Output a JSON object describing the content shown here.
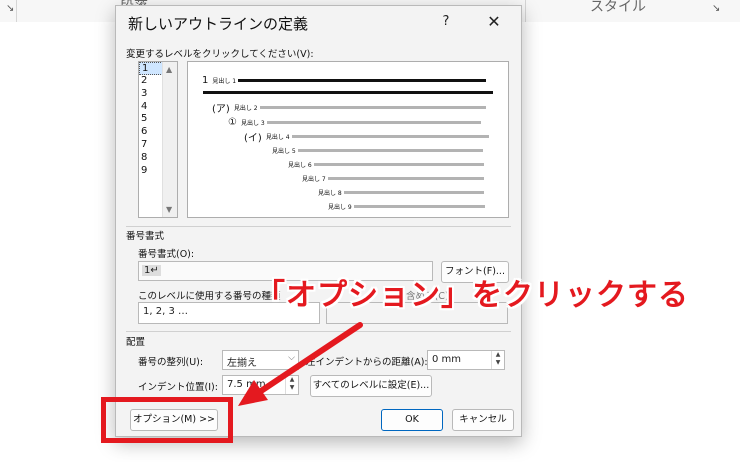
{
  "background": {
    "ribbon_left_label": "段落",
    "ribbon_right_label": "スタイル",
    "launcher_glyph": "↘"
  },
  "dialog": {
    "title": "新しいアウトラインの定義",
    "help_glyph": "?",
    "close_glyph": "✕",
    "level_prompt": "変更するレベルをクリックしてください(V):",
    "levels": [
      "1",
      "2",
      "3",
      "4",
      "5",
      "6",
      "7",
      "8",
      "9"
    ],
    "selected_level": "1",
    "preview": [
      {
        "number": "1",
        "label": "見出し 1"
      },
      {
        "number": "(ア)",
        "label": "見出し 2"
      },
      {
        "number": "①",
        "label": "見出し 3"
      },
      {
        "number": "(イ)",
        "label": "見出し 4"
      },
      {
        "number": "",
        "label": "見出し 5"
      },
      {
        "number": "",
        "label": "見出し 6"
      },
      {
        "number": "",
        "label": "見出し 7"
      },
      {
        "number": "",
        "label": "見出し 8"
      },
      {
        "number": "",
        "label": "見出し 9"
      }
    ],
    "number_format_section": "番号書式",
    "number_format_label": "番号書式(O):",
    "number_format_value": "1↵",
    "font_button": "フォント(F)...",
    "number_style_label": "このレベルに使用する番号の種類",
    "number_style_value": "1, 2, 3 …",
    "include_level_label": "含める(C):",
    "placement_section": "配置",
    "alignment_label": "番号の整列(U):",
    "alignment_value": "左揃え",
    "left_indent_label": "左インデントからの距離(A):",
    "left_indent_value": "0 mm",
    "indent_pos_label": "インデント位置(I):",
    "indent_pos_value": "7.5 mm",
    "set_all_button": "すべてのレベルに設定(E)...",
    "options_button": "オプション(M) >>",
    "ok_button": "OK",
    "cancel_button": "キャンセル"
  },
  "annotation": {
    "callout_text": "「オプション」をクリックする",
    "color": "#e4191f"
  }
}
